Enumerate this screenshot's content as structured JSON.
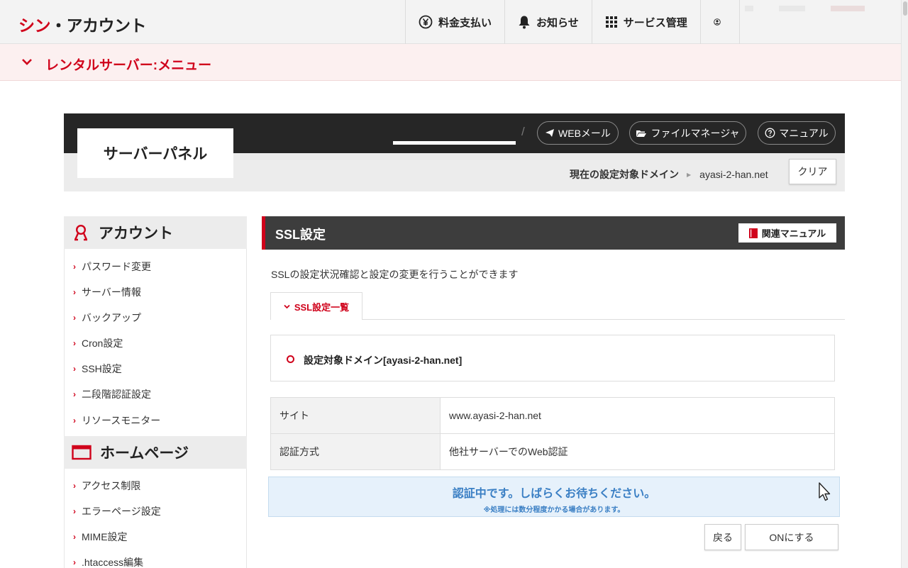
{
  "header": {
    "logo_part1": "シン",
    "logo_part2": "・アカウント",
    "nav": [
      {
        "label": "料金支払い",
        "icon": "yen-icon"
      },
      {
        "label": "お知らせ",
        "icon": "bell-icon"
      },
      {
        "label": "サービス管理",
        "icon": "grid-icon"
      },
      {
        "label": "",
        "icon": "user-icon"
      }
    ]
  },
  "rental_menu": {
    "label": "レンタルサーバー:メニュー"
  },
  "panel": {
    "title": "サーバーパネル",
    "links": {
      "webmail": "WEBメール",
      "file_manager": "ファイルマネージャ",
      "manual": "マニュアル"
    },
    "current_domain_label": "現在の設定対象ドメイン",
    "current_domain": "ayasi-2-han.net",
    "clear": "クリア"
  },
  "sidebar": {
    "account": {
      "title": "アカウント",
      "items": [
        "パスワード変更",
        "サーバー情報",
        "バックアップ",
        "Cron設定",
        "SSH設定",
        "二段階認証設定",
        "リソースモニター"
      ]
    },
    "homepage": {
      "title": "ホームページ",
      "items": [
        "アクセス制限",
        "エラーページ設定",
        "MIME設定",
        ".htaccess編集"
      ]
    }
  },
  "main": {
    "title": "SSL設定",
    "related_manual": "関連マニュアル",
    "description": "SSLの設定状況確認と設定の変更を行うことができます",
    "tab": "SSL設定一覧",
    "domain_heading": "設定対象ドメイン[ayasi-2-han.net]",
    "table": [
      {
        "label": "サイト",
        "value": "www.ayasi-2-han.net"
      },
      {
        "label": "認証方式",
        "value": "他社サーバーでのWeb認証"
      }
    ],
    "notice_main": "認証中です。しばらくお待ちください。",
    "notice_sub": "※処理には数分程度かかる場合があります。",
    "back": "戻る",
    "on": "ONにする"
  },
  "colors": {
    "accent": "#d0021b",
    "notice_text": "#3a7fc4",
    "notice_bg": "#e6f1fb",
    "panel_dark": "#262626"
  }
}
